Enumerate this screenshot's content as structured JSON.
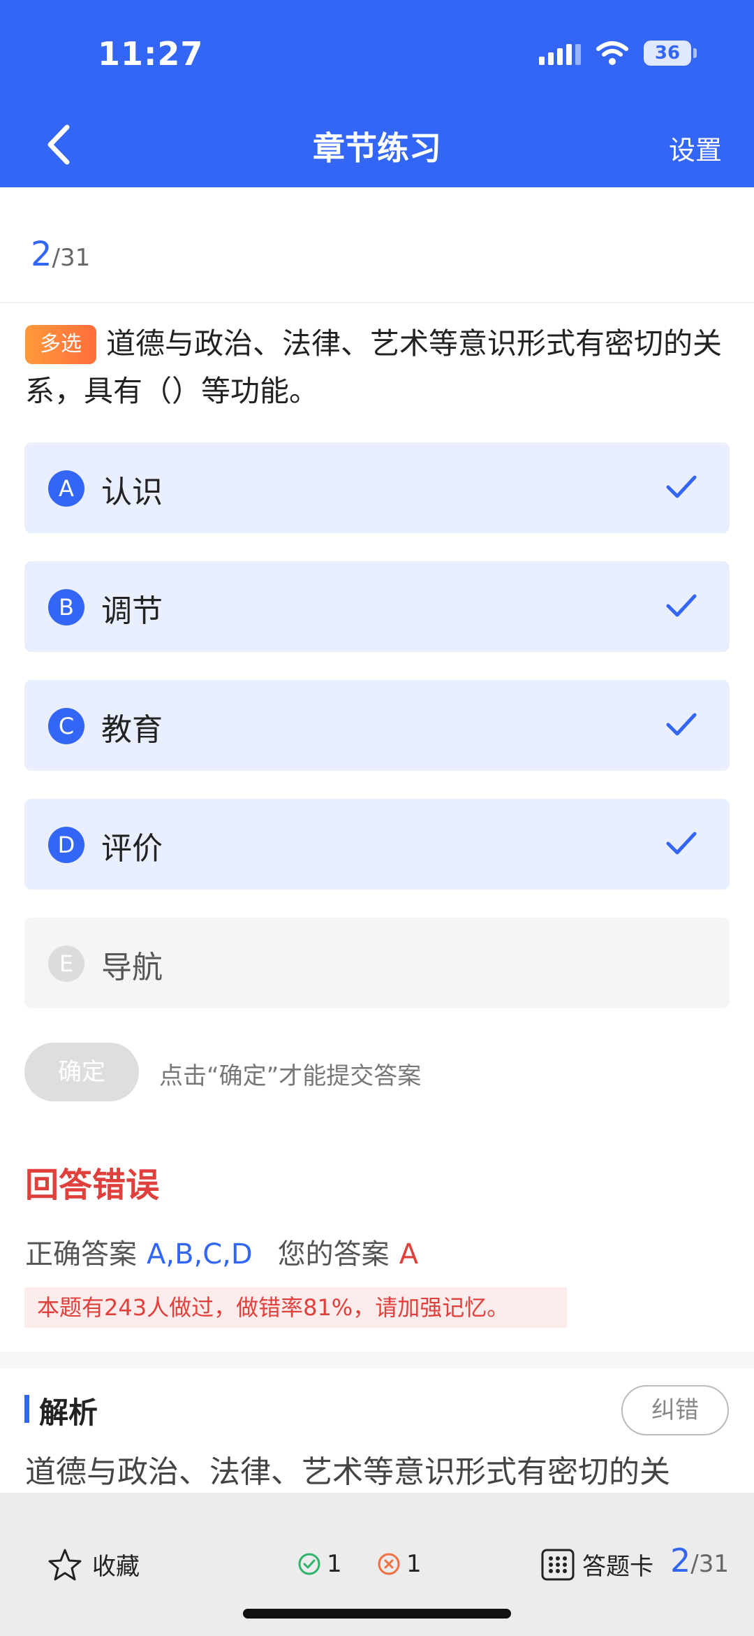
{
  "status": {
    "time": "11:27",
    "battery": "36"
  },
  "nav": {
    "back_icon": "chevron-left-icon",
    "title": "章节练习",
    "settings_label": "设置"
  },
  "progress": {
    "current": "2",
    "total": "/31"
  },
  "question": {
    "type_tag": "多选",
    "text": "道德与政治、法律、艺术等意识形式有密切的关系，具有（）等功能。"
  },
  "options": [
    {
      "letter": "A",
      "text": "认识",
      "selected": true
    },
    {
      "letter": "B",
      "text": "调节",
      "selected": true
    },
    {
      "letter": "C",
      "text": "教育",
      "selected": true
    },
    {
      "letter": "D",
      "text": "评价",
      "selected": true
    },
    {
      "letter": "E",
      "text": "导航",
      "selected": false
    }
  ],
  "submit": {
    "button_label": "确定",
    "hint": "点击“确定”才能提交答案"
  },
  "result": {
    "title": "回答错误",
    "correct_label": "正确答案",
    "correct_value": "A,B,C,D",
    "mine_label": "您的答案",
    "mine_value": "A",
    "note": "本题有243人做过，做错率81%，请加强记忆。"
  },
  "analysis": {
    "title": "解析",
    "report_label": "纠错",
    "text": "道德与政治、法律、艺术等意识形式有密切的关"
  },
  "bottom": {
    "favorite_label": "收藏",
    "correct_count": "1",
    "wrong_count": "1",
    "card_label": "答题卡",
    "current": "2",
    "total": "/31"
  },
  "colors": {
    "primary": "#3366f5",
    "error": "#e0403c",
    "tag": "#ff7a3b"
  }
}
